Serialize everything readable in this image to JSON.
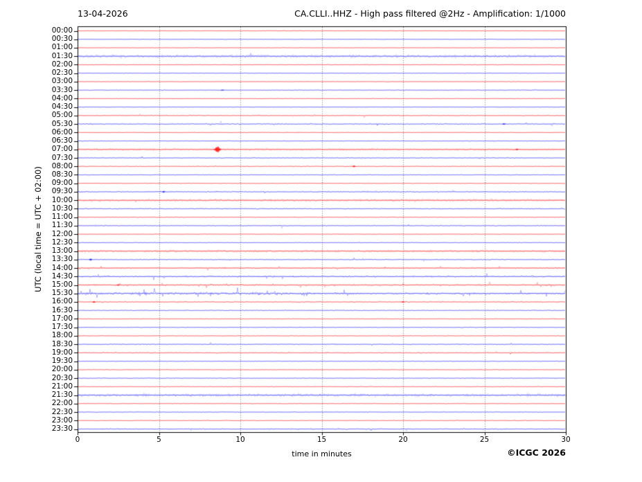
{
  "header": {
    "date": "13-04-2026",
    "title": "CA.CLLI..HHZ - High pass filtered @2Hz - Amplification: 1/1000"
  },
  "footer": {
    "copyright": "©ICGC 2026"
  },
  "axes": {
    "ylabel": "UTC (local time = UTC + 02:00)",
    "xlabel": "time in minutes",
    "x_ticks": [
      0,
      5,
      10,
      15,
      20,
      25,
      30
    ],
    "x_range": [
      0,
      30
    ],
    "grid_minutes": [
      5,
      10,
      15,
      20,
      25
    ]
  },
  "chart_data": {
    "type": "line",
    "subtype": "helicorder-dayplot",
    "title": "CA.CLLI..HHZ - High pass filtered @2Hz - Amplification: 1/1000",
    "date": "13-04-2026",
    "station": "CA.CLLI..HHZ",
    "filter": "High pass filtered @2Hz",
    "amplification": "1/1000",
    "minutes_per_line": 30,
    "xlabel": "time in minutes",
    "ylabel": "UTC (local time = UTC + 02:00)",
    "x_range": [
      0,
      30
    ],
    "grid_minutes": [
      5,
      10,
      15,
      20,
      25
    ],
    "colors": {
      "red_trace": "#ff0000",
      "blue_trace": "#1414ff",
      "grid": "#444444",
      "frame": "#000000"
    },
    "rows": [
      {
        "time": "00:00",
        "color": "red",
        "amp": 0.5,
        "style": "quiet"
      },
      {
        "time": "00:30",
        "color": "blue",
        "amp": 0.5,
        "style": "quiet"
      },
      {
        "time": "01:00",
        "color": "red",
        "amp": 0.5,
        "style": "quiet"
      },
      {
        "time": "01:30",
        "color": "blue",
        "amp": 1.7,
        "style": "band"
      },
      {
        "time": "02:00",
        "color": "red",
        "amp": 0.6,
        "style": "quiet"
      },
      {
        "time": "02:30",
        "color": "blue",
        "amp": 0.5,
        "style": "quiet"
      },
      {
        "time": "03:00",
        "color": "red",
        "amp": 0.5,
        "style": "quiet"
      },
      {
        "time": "03:30",
        "color": "blue",
        "amp": 0.6,
        "style": "quiet"
      },
      {
        "time": "04:00",
        "color": "red",
        "amp": 0.5,
        "style": "quiet"
      },
      {
        "time": "04:30",
        "color": "blue",
        "amp": 0.5,
        "style": "quiet"
      },
      {
        "time": "05:00",
        "color": "red",
        "amp": 0.7,
        "style": "mild"
      },
      {
        "time": "05:30",
        "color": "blue",
        "amp": 0.9,
        "style": "mild"
      },
      {
        "time": "06:00",
        "color": "red",
        "amp": 0.6,
        "style": "quiet"
      },
      {
        "time": "06:30",
        "color": "blue",
        "amp": 0.6,
        "style": "quiet"
      },
      {
        "time": "07:00",
        "color": "red",
        "amp": 1.2,
        "style": "band"
      },
      {
        "time": "07:30",
        "color": "blue",
        "amp": 0.7,
        "style": "mild"
      },
      {
        "time": "08:00",
        "color": "red",
        "amp": 0.6,
        "style": "quiet"
      },
      {
        "time": "08:30",
        "color": "blue",
        "amp": 0.6,
        "style": "quiet"
      },
      {
        "time": "09:00",
        "color": "red",
        "amp": 0.6,
        "style": "quiet"
      },
      {
        "time": "09:30",
        "color": "blue",
        "amp": 0.9,
        "style": "mild"
      },
      {
        "time": "10:00",
        "color": "red",
        "amp": 1.5,
        "style": "band"
      },
      {
        "time": "10:30",
        "color": "blue",
        "amp": 0.8,
        "style": "mild"
      },
      {
        "time": "11:00",
        "color": "red",
        "amp": 0.6,
        "style": "quiet"
      },
      {
        "time": "11:30",
        "color": "blue",
        "amp": 0.7,
        "style": "mild"
      },
      {
        "time": "12:00",
        "color": "red",
        "amp": 0.5,
        "style": "quiet"
      },
      {
        "time": "12:30",
        "color": "blue",
        "amp": 0.6,
        "style": "quiet"
      },
      {
        "time": "13:00",
        "color": "red",
        "amp": 1.4,
        "style": "band"
      },
      {
        "time": "13:30",
        "color": "blue",
        "amp": 0.8,
        "style": "mild"
      },
      {
        "time": "14:00",
        "color": "red",
        "amp": 0.9,
        "style": "spiky"
      },
      {
        "time": "14:30",
        "color": "blue",
        "amp": 1.2,
        "style": "spiky"
      },
      {
        "time": "15:00",
        "color": "red",
        "amp": 1.2,
        "style": "spiky"
      },
      {
        "time": "15:30",
        "color": "blue",
        "amp": 1.8,
        "style": "spiky-heavy"
      },
      {
        "time": "16:00",
        "color": "red",
        "amp": 0.8,
        "style": "mild"
      },
      {
        "time": "16:30",
        "color": "blue",
        "amp": 0.6,
        "style": "quiet"
      },
      {
        "time": "17:00",
        "color": "red",
        "amp": 0.6,
        "style": "quiet"
      },
      {
        "time": "17:30",
        "color": "blue",
        "amp": 0.6,
        "style": "quiet"
      },
      {
        "time": "18:00",
        "color": "red",
        "amp": 0.6,
        "style": "quiet"
      },
      {
        "time": "18:30",
        "color": "blue",
        "amp": 0.7,
        "style": "mild"
      },
      {
        "time": "19:00",
        "color": "red",
        "amp": 0.8,
        "style": "mild"
      },
      {
        "time": "19:30",
        "color": "blue",
        "amp": 0.6,
        "style": "quiet"
      },
      {
        "time": "20:00",
        "color": "red",
        "amp": 0.6,
        "style": "quiet"
      },
      {
        "time": "20:30",
        "color": "blue",
        "amp": 0.6,
        "style": "quiet"
      },
      {
        "time": "21:00",
        "color": "red",
        "amp": 0.6,
        "style": "quiet"
      },
      {
        "time": "21:30",
        "color": "blue",
        "amp": 1.7,
        "style": "band"
      },
      {
        "time": "22:00",
        "color": "red",
        "amp": 0.6,
        "style": "quiet"
      },
      {
        "time": "22:30",
        "color": "blue",
        "amp": 0.6,
        "style": "quiet"
      },
      {
        "time": "23:00",
        "color": "red",
        "amp": 0.6,
        "style": "quiet"
      },
      {
        "time": "23:30",
        "color": "blue",
        "amp": 0.7,
        "style": "mild"
      }
    ],
    "events": [
      {
        "time": "03:30",
        "minute": 8.9,
        "amplitude": 0.9
      },
      {
        "time": "05:30",
        "minute": 26.2,
        "amplitude": 1.1
      },
      {
        "time": "07:00",
        "minute": 8.6,
        "amplitude": 4.5
      },
      {
        "time": "07:00",
        "minute": 27.0,
        "amplitude": 1.2
      },
      {
        "time": "08:00",
        "minute": 17.0,
        "amplitude": 1.6
      },
      {
        "time": "09:30",
        "minute": 5.3,
        "amplitude": 1.3
      },
      {
        "time": "13:30",
        "minute": 0.8,
        "amplitude": 1.5
      },
      {
        "time": "15:00",
        "minute": 2.5,
        "amplitude": 1.2
      },
      {
        "time": "16:00",
        "minute": 1.0,
        "amplitude": 1.4
      },
      {
        "time": "16:00",
        "minute": 20.0,
        "amplitude": 1.0
      }
    ]
  }
}
